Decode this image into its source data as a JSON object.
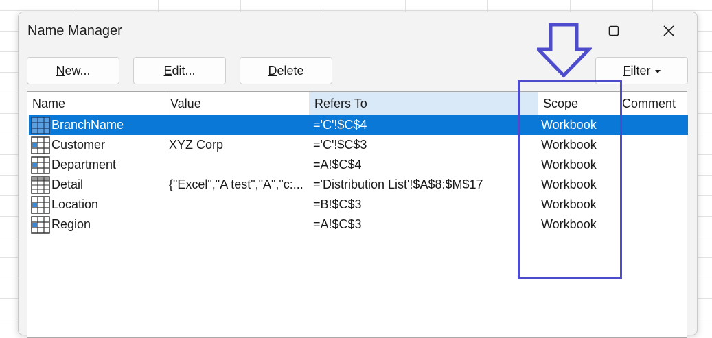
{
  "window": {
    "title": "Name Manager"
  },
  "toolbar": {
    "new_label_accel": "N",
    "new_label_rest": "ew...",
    "edit_label_accel": "E",
    "edit_label_rest": "dit...",
    "delete_label_accel": "D",
    "delete_label_rest": "elete",
    "filter_label_accel": "F",
    "filter_label_rest": "ilter"
  },
  "table": {
    "headers": {
      "name": "Name",
      "value": "Value",
      "refers_to": "Refers To",
      "scope": "Scope",
      "comment": "Comment"
    },
    "rows": [
      {
        "icon": "named-range-icon",
        "name": "BranchName",
        "value": "",
        "refers_to": "='C'!$C$4",
        "scope": "Workbook",
        "comment": "",
        "selected": true
      },
      {
        "icon": "named-range-icon",
        "name": "Customer",
        "value": "XYZ Corp",
        "refers_to": "='C'!$C$3",
        "scope": "Workbook",
        "comment": ""
      },
      {
        "icon": "named-range-icon",
        "name": "Department",
        "value": "",
        "refers_to": "=A!$C$4",
        "scope": "Workbook",
        "comment": ""
      },
      {
        "icon": "table-range-icon",
        "name": "Detail",
        "value": "{\"Excel\",\"A test\",\"A\",\"c:...",
        "refers_to": "='Distribution List'!$A$8:$M$17",
        "scope": "Workbook",
        "comment": ""
      },
      {
        "icon": "named-range-icon",
        "name": "Location",
        "value": "",
        "refers_to": "=B!$C$3",
        "scope": "Workbook",
        "comment": ""
      },
      {
        "icon": "named-range-icon",
        "name": "Region",
        "value": "",
        "refers_to": "=A!$C$3",
        "scope": "Workbook",
        "comment": ""
      }
    ]
  },
  "annotation": {
    "color": "#4c4ccc",
    "arrow": "down-arrow-icon"
  },
  "colors": {
    "selection": "#0a78d7",
    "refers_header": "#d9e9f8"
  }
}
